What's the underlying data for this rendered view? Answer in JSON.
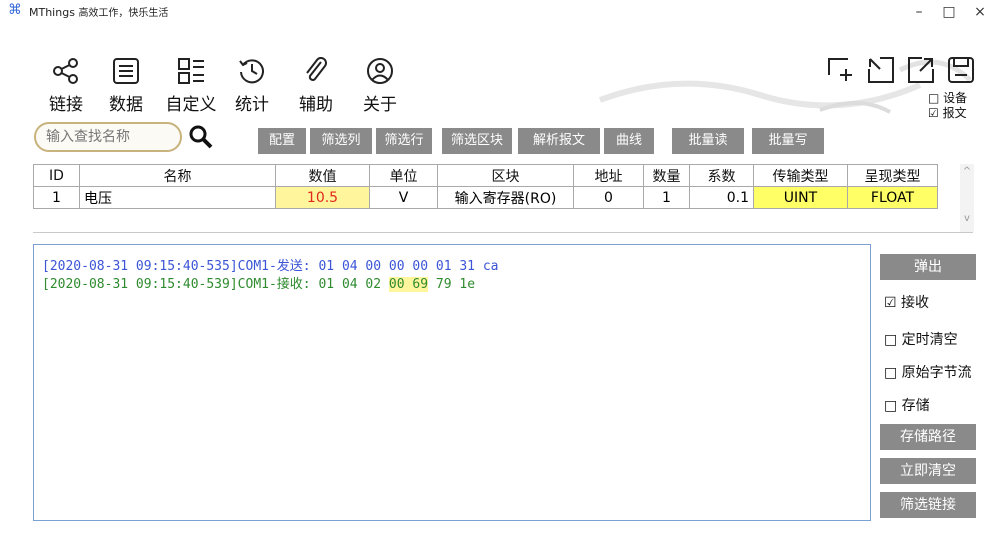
{
  "window": {
    "app_name": "MThings",
    "tagline": "高效工作，快乐生活",
    "minimize": "–",
    "maximize": "□",
    "close": "×"
  },
  "nav": [
    {
      "label": "链接",
      "icon": "share-icon"
    },
    {
      "label": "数据",
      "icon": "list-icon"
    },
    {
      "label": "自定义",
      "icon": "custom-list-icon"
    },
    {
      "label": "统计",
      "icon": "history-icon"
    },
    {
      "label": "辅助",
      "icon": "paperclip-icon"
    },
    {
      "label": "关于",
      "icon": "user-icon"
    }
  ],
  "right_tools": {
    "checkbox_device": "□ 设备",
    "checkbox_message": "☑ 报文"
  },
  "toolbar": {
    "search_placeholder": "输入查找名称",
    "buttons": [
      "配置",
      "筛选列",
      "筛选行",
      "筛选区块",
      "解析报文",
      "曲线",
      "批量读",
      "批量写"
    ]
  },
  "table": {
    "headers": [
      "ID",
      "名称",
      "数值",
      "单位",
      "区块",
      "地址",
      "数量",
      "系数",
      "传输类型",
      "呈现类型"
    ],
    "rows": [
      {
        "id": "1",
        "name": "电压",
        "value": "10.5",
        "unit": "V",
        "block": "输入寄存器(RO)",
        "address": "0",
        "count": "1",
        "factor": "0.1",
        "transfer_type": "UINT",
        "display_type": "FLOAT"
      }
    ]
  },
  "log": [
    {
      "prefix": "[2020-08-31 09:15:40-535]COM1-发送: ",
      "data_a": "01 04 00 00 00 01 31 ca",
      "highlight": "",
      "data_b": "",
      "color": "#3b55d6"
    },
    {
      "prefix": "[2020-08-31 09:15:40-539]COM1-接收: ",
      "data_a": "01 04 02 ",
      "highlight": "00 69",
      "data_b": " 79 1e",
      "color": "#2e8b2e"
    }
  ],
  "side": {
    "popup": "弹出",
    "receive": "☑ 接收",
    "timed_clear": "□ 定时清空",
    "raw_stream": "□ 原始字节流",
    "store": "□ 存储",
    "store_path": "存储路径",
    "clear_now": "立即清空",
    "filter_link": "筛选链接"
  },
  "colors": {
    "value_bg": "#fff59d",
    "value_text": "#e0291b",
    "type_bg": "#ffff66",
    "send_text": "#3b55d6",
    "recv_text": "#2e8b2e",
    "button_gray": "#8a8a8a"
  }
}
